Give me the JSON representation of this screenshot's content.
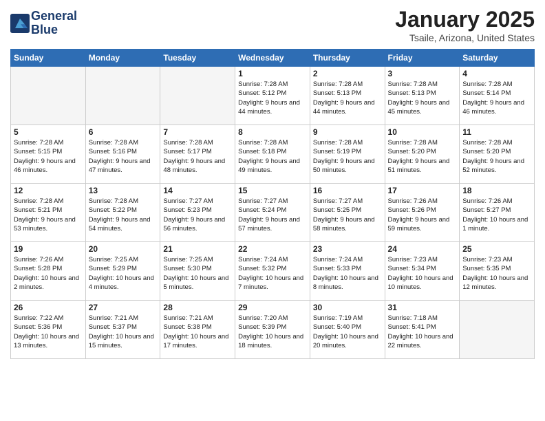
{
  "header": {
    "logo_line1": "General",
    "logo_line2": "Blue",
    "month": "January 2025",
    "location": "Tsaile, Arizona, United States"
  },
  "days_of_week": [
    "Sunday",
    "Monday",
    "Tuesday",
    "Wednesday",
    "Thursday",
    "Friday",
    "Saturday"
  ],
  "weeks": [
    [
      {
        "day": "",
        "empty": true
      },
      {
        "day": "",
        "empty": true
      },
      {
        "day": "",
        "empty": true
      },
      {
        "day": "1",
        "sunrise": "Sunrise: 7:28 AM",
        "sunset": "Sunset: 5:12 PM",
        "daylight": "Daylight: 9 hours and 44 minutes."
      },
      {
        "day": "2",
        "sunrise": "Sunrise: 7:28 AM",
        "sunset": "Sunset: 5:13 PM",
        "daylight": "Daylight: 9 hours and 44 minutes."
      },
      {
        "day": "3",
        "sunrise": "Sunrise: 7:28 AM",
        "sunset": "Sunset: 5:13 PM",
        "daylight": "Daylight: 9 hours and 45 minutes."
      },
      {
        "day": "4",
        "sunrise": "Sunrise: 7:28 AM",
        "sunset": "Sunset: 5:14 PM",
        "daylight": "Daylight: 9 hours and 46 minutes."
      }
    ],
    [
      {
        "day": "5",
        "sunrise": "Sunrise: 7:28 AM",
        "sunset": "Sunset: 5:15 PM",
        "daylight": "Daylight: 9 hours and 46 minutes."
      },
      {
        "day": "6",
        "sunrise": "Sunrise: 7:28 AM",
        "sunset": "Sunset: 5:16 PM",
        "daylight": "Daylight: 9 hours and 47 minutes."
      },
      {
        "day": "7",
        "sunrise": "Sunrise: 7:28 AM",
        "sunset": "Sunset: 5:17 PM",
        "daylight": "Daylight: 9 hours and 48 minutes."
      },
      {
        "day": "8",
        "sunrise": "Sunrise: 7:28 AM",
        "sunset": "Sunset: 5:18 PM",
        "daylight": "Daylight: 9 hours and 49 minutes."
      },
      {
        "day": "9",
        "sunrise": "Sunrise: 7:28 AM",
        "sunset": "Sunset: 5:19 PM",
        "daylight": "Daylight: 9 hours and 50 minutes."
      },
      {
        "day": "10",
        "sunrise": "Sunrise: 7:28 AM",
        "sunset": "Sunset: 5:20 PM",
        "daylight": "Daylight: 9 hours and 51 minutes."
      },
      {
        "day": "11",
        "sunrise": "Sunrise: 7:28 AM",
        "sunset": "Sunset: 5:20 PM",
        "daylight": "Daylight: 9 hours and 52 minutes."
      }
    ],
    [
      {
        "day": "12",
        "sunrise": "Sunrise: 7:28 AM",
        "sunset": "Sunset: 5:21 PM",
        "daylight": "Daylight: 9 hours and 53 minutes."
      },
      {
        "day": "13",
        "sunrise": "Sunrise: 7:28 AM",
        "sunset": "Sunset: 5:22 PM",
        "daylight": "Daylight: 9 hours and 54 minutes."
      },
      {
        "day": "14",
        "sunrise": "Sunrise: 7:27 AM",
        "sunset": "Sunset: 5:23 PM",
        "daylight": "Daylight: 9 hours and 56 minutes."
      },
      {
        "day": "15",
        "sunrise": "Sunrise: 7:27 AM",
        "sunset": "Sunset: 5:24 PM",
        "daylight": "Daylight: 9 hours and 57 minutes."
      },
      {
        "day": "16",
        "sunrise": "Sunrise: 7:27 AM",
        "sunset": "Sunset: 5:25 PM",
        "daylight": "Daylight: 9 hours and 58 minutes."
      },
      {
        "day": "17",
        "sunrise": "Sunrise: 7:26 AM",
        "sunset": "Sunset: 5:26 PM",
        "daylight": "Daylight: 9 hours and 59 minutes."
      },
      {
        "day": "18",
        "sunrise": "Sunrise: 7:26 AM",
        "sunset": "Sunset: 5:27 PM",
        "daylight": "Daylight: 10 hours and 1 minute."
      }
    ],
    [
      {
        "day": "19",
        "sunrise": "Sunrise: 7:26 AM",
        "sunset": "Sunset: 5:28 PM",
        "daylight": "Daylight: 10 hours and 2 minutes."
      },
      {
        "day": "20",
        "sunrise": "Sunrise: 7:25 AM",
        "sunset": "Sunset: 5:29 PM",
        "daylight": "Daylight: 10 hours and 4 minutes."
      },
      {
        "day": "21",
        "sunrise": "Sunrise: 7:25 AM",
        "sunset": "Sunset: 5:30 PM",
        "daylight": "Daylight: 10 hours and 5 minutes."
      },
      {
        "day": "22",
        "sunrise": "Sunrise: 7:24 AM",
        "sunset": "Sunset: 5:32 PM",
        "daylight": "Daylight: 10 hours and 7 minutes."
      },
      {
        "day": "23",
        "sunrise": "Sunrise: 7:24 AM",
        "sunset": "Sunset: 5:33 PM",
        "daylight": "Daylight: 10 hours and 8 minutes."
      },
      {
        "day": "24",
        "sunrise": "Sunrise: 7:23 AM",
        "sunset": "Sunset: 5:34 PM",
        "daylight": "Daylight: 10 hours and 10 minutes."
      },
      {
        "day": "25",
        "sunrise": "Sunrise: 7:23 AM",
        "sunset": "Sunset: 5:35 PM",
        "daylight": "Daylight: 10 hours and 12 minutes."
      }
    ],
    [
      {
        "day": "26",
        "sunrise": "Sunrise: 7:22 AM",
        "sunset": "Sunset: 5:36 PM",
        "daylight": "Daylight: 10 hours and 13 minutes."
      },
      {
        "day": "27",
        "sunrise": "Sunrise: 7:21 AM",
        "sunset": "Sunset: 5:37 PM",
        "daylight": "Daylight: 10 hours and 15 minutes."
      },
      {
        "day": "28",
        "sunrise": "Sunrise: 7:21 AM",
        "sunset": "Sunset: 5:38 PM",
        "daylight": "Daylight: 10 hours and 17 minutes."
      },
      {
        "day": "29",
        "sunrise": "Sunrise: 7:20 AM",
        "sunset": "Sunset: 5:39 PM",
        "daylight": "Daylight: 10 hours and 18 minutes."
      },
      {
        "day": "30",
        "sunrise": "Sunrise: 7:19 AM",
        "sunset": "Sunset: 5:40 PM",
        "daylight": "Daylight: 10 hours and 20 minutes."
      },
      {
        "day": "31",
        "sunrise": "Sunrise: 7:18 AM",
        "sunset": "Sunset: 5:41 PM",
        "daylight": "Daylight: 10 hours and 22 minutes."
      },
      {
        "day": "",
        "empty": true
      }
    ]
  ]
}
